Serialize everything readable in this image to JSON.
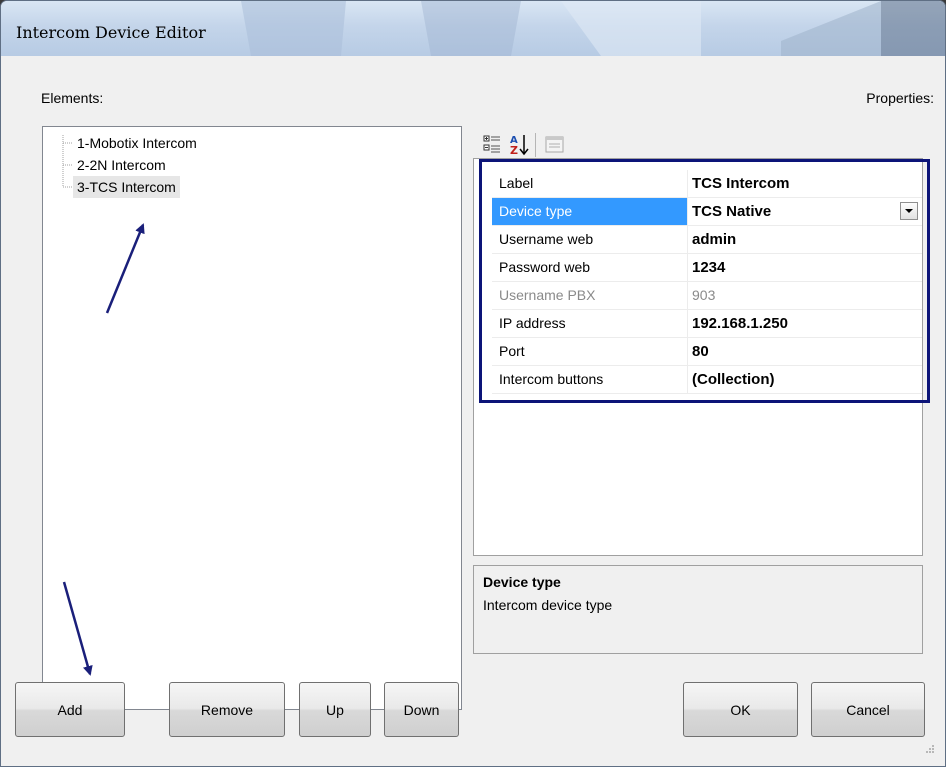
{
  "window": {
    "title": "Intercom Device Editor"
  },
  "labels": {
    "elements": "Elements:",
    "properties": "Properties:"
  },
  "tree": {
    "items": [
      {
        "label": "1-Mobotix Intercom",
        "selected": false
      },
      {
        "label": "2-2N Intercom",
        "selected": false
      },
      {
        "label": "3-TCS Intercom",
        "selected": true
      }
    ]
  },
  "toolbar": {
    "icons": [
      "categorized-icon",
      "alphabetical-sort-icon",
      "property-pages-icon"
    ]
  },
  "properties": [
    {
      "name": "Label",
      "value": "TCS Intercom",
      "selected": false,
      "readonly": false
    },
    {
      "name": "Device type",
      "value": "TCS Native",
      "selected": true,
      "readonly": false,
      "dropdown": true
    },
    {
      "name": "Username web",
      "value": "admin",
      "selected": false,
      "readonly": false
    },
    {
      "name": "Password web",
      "value": "1234",
      "selected": false,
      "readonly": false
    },
    {
      "name": "Username PBX",
      "value": "903",
      "selected": false,
      "readonly": true
    },
    {
      "name": "IP address",
      "value": "192.168.1.250",
      "selected": false,
      "readonly": false
    },
    {
      "name": "Port",
      "value": "80",
      "selected": false,
      "readonly": false
    },
    {
      "name": "Intercom buttons",
      "value": "(Collection)",
      "selected": false,
      "readonly": false
    }
  ],
  "help": {
    "title": "Device type",
    "description": "Intercom device type"
  },
  "buttons": {
    "add": "Add",
    "remove": "Remove",
    "up": "Up",
    "down": "Down",
    "ok": "OK",
    "cancel": "Cancel"
  },
  "colors": {
    "selection": "#3399ff",
    "focus_frame": "#0c1478",
    "annotation_arrow": "#1a1f7a"
  }
}
